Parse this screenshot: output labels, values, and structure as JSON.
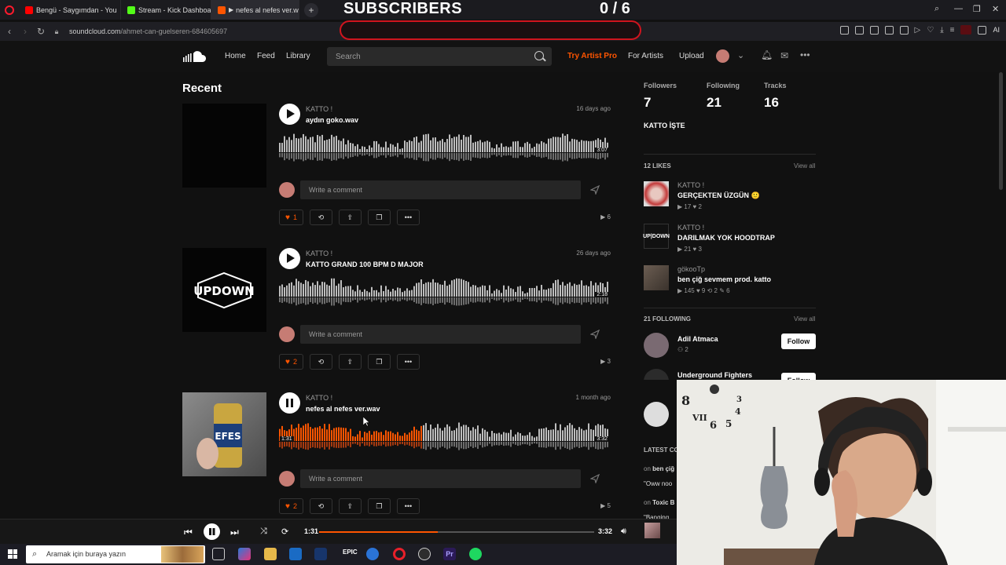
{
  "overlay": {
    "subscribers_label": "SUBSCRIBERS",
    "subscribers_count": "0 / 6"
  },
  "browser": {
    "tabs": [
      {
        "label": "Bengü - Saygımdan - You",
        "fav_color": "#ff0000"
      },
      {
        "label": "Stream - Kick Dashboard",
        "fav_color": "#53fc18"
      },
      {
        "label": "nefes al nefes ver.w",
        "fav_color": "#ff5500"
      }
    ],
    "url_host": "soundcloud.com",
    "url_path": "/ahmet-can-guelseren-684605697",
    "ai_label": "AI"
  },
  "header": {
    "nav": [
      "Home",
      "Feed",
      "Library"
    ],
    "search_placeholder": "Search",
    "try_pro": "Try Artist Pro",
    "for_artists": "For Artists",
    "upload": "Upload"
  },
  "feed": {
    "section_title": "Recent",
    "comment_placeholder": "Write a comment",
    "tracks": [
      {
        "artist": "KATTO !",
        "title": "aydın goko.wav",
        "date": "16 days ago",
        "duration": "3:07",
        "likes": "1",
        "plays": "6",
        "playing": false
      },
      {
        "artist": "KATTO !",
        "title": "KATTO GRAND 100 BPM D MAJOR",
        "date": "26 days ago",
        "duration": "2:18",
        "likes": "2",
        "plays": "3",
        "playing": false
      },
      {
        "artist": "KATTO !",
        "title": "nefes al nefes ver.wav",
        "date": "1 month ago",
        "duration": "3:32",
        "elapsed": "1:31",
        "likes": "2",
        "plays": "5",
        "playing": true,
        "progress": 0.43
      }
    ]
  },
  "sidebar": {
    "stats": [
      {
        "label": "Followers",
        "value": "7"
      },
      {
        "label": "Following",
        "value": "21"
      },
      {
        "label": "Tracks",
        "value": "16"
      }
    ],
    "bio": "KATTO İŞTE",
    "likes_header": "12 LIKES",
    "view_all": "View all",
    "likes": [
      {
        "artist": "KATTO !",
        "title": "GERÇEKTEN ÜZGÜN 🙂",
        "stats": "▶ 17 ♥ 2"
      },
      {
        "artist": "KATTO !",
        "title": "DARILMAK YOK HOODTRAP",
        "stats": "▶ 21 ♥ 3"
      },
      {
        "artist": "gökooTp",
        "title": "ben çiğ sevmem prod. katto",
        "stats": "▶ 145 ♥ 9 ⟲ 2 ✎ 6"
      }
    ],
    "following_header": "21 FOLLOWING",
    "following": [
      {
        "name": "Adil Atmaca",
        "count": "2",
        "follow_label": "Follow"
      },
      {
        "name": "Underground Fighters",
        "count": "",
        "follow_label": "Follow"
      }
    ],
    "latest_header": "LATEST CO",
    "comments": [
      {
        "on": "on",
        "track": "ben çiğ",
        "text": "\"Oww noo"
      },
      {
        "on": "on",
        "track": "Toxic B",
        "text": "\"Banging"
      }
    ]
  },
  "player": {
    "elapsed": "1:31",
    "duration": "3:32",
    "progress": 0.43
  },
  "taskbar": {
    "search_placeholder": "Aramak için buraya yazın"
  },
  "colors": {
    "accent": "#ff5500",
    "overlay_red": "#d0141e"
  }
}
